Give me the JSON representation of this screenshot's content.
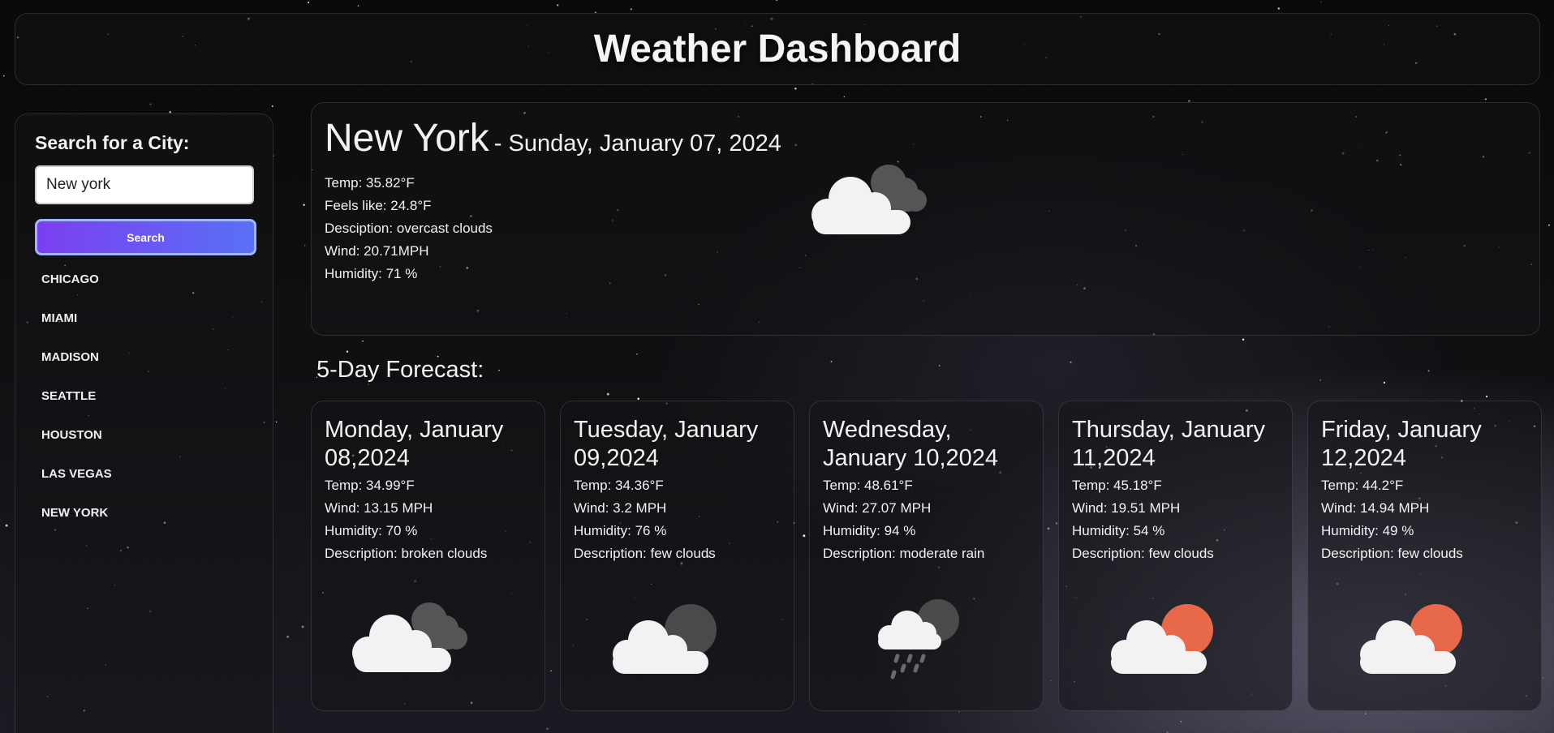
{
  "header": {
    "title": "Weather Dashboard"
  },
  "sidebar": {
    "heading": "Search for a City:",
    "search_value": "New york",
    "search_button": "Search",
    "cities": [
      "CHICAGO",
      "MIAMI",
      "MADISON",
      "SEATTLE",
      "HOUSTON",
      "LAS VEGAS",
      "NEW YORK"
    ]
  },
  "current": {
    "city": "New York",
    "date": "- Sunday, January 07, 2024",
    "temp": "Temp: 35.82°F",
    "feels": "Feels like: 24.8°F",
    "desc": "Desciption: overcast clouds",
    "wind": "Wind: 20.71MPH",
    "humidity": "Humidity: 71 %",
    "icon": "overcast-clouds-icon"
  },
  "forecast": {
    "label": "5-Day Forecast:",
    "days": [
      {
        "date": "Monday, January 08,2024",
        "temp": "Temp: 34.99°F",
        "wind": "Wind: 13.15 MPH",
        "humidity": "Humidity: 70 %",
        "desc": "Description: broken clouds",
        "icon": "broken-clouds-icon"
      },
      {
        "date": "Tuesday, January 09,2024",
        "temp": "Temp: 34.36°F",
        "wind": "Wind: 3.2 MPH",
        "humidity": "Humidity: 76 %",
        "desc": "Description: few clouds",
        "icon": "few-clouds-night-icon"
      },
      {
        "date": "Wednesday, January 10,2024",
        "temp": "Temp: 48.61°F",
        "wind": "Wind: 27.07 MPH",
        "humidity": "Humidity: 94 %",
        "desc": "Description: moderate rain",
        "icon": "rain-icon"
      },
      {
        "date": "Thursday, January 11,2024",
        "temp": "Temp: 45.18°F",
        "wind": "Wind: 19.51 MPH",
        "humidity": "Humidity: 54 %",
        "desc": "Description: few clouds",
        "icon": "few-clouds-day-icon"
      },
      {
        "date": "Friday, January 12,2024",
        "temp": "Temp: 44.2°F",
        "wind": "Wind: 14.94 MPH",
        "humidity": "Humidity: 49 %",
        "desc": "Description: few clouds",
        "icon": "few-clouds-day-icon"
      }
    ]
  },
  "colors": {
    "button_start": "#7b3ff0",
    "button_end": "#5a70f5",
    "sun": "#e8694a",
    "cloud": "#f2f2f2",
    "dark_cloud": "#555555"
  }
}
